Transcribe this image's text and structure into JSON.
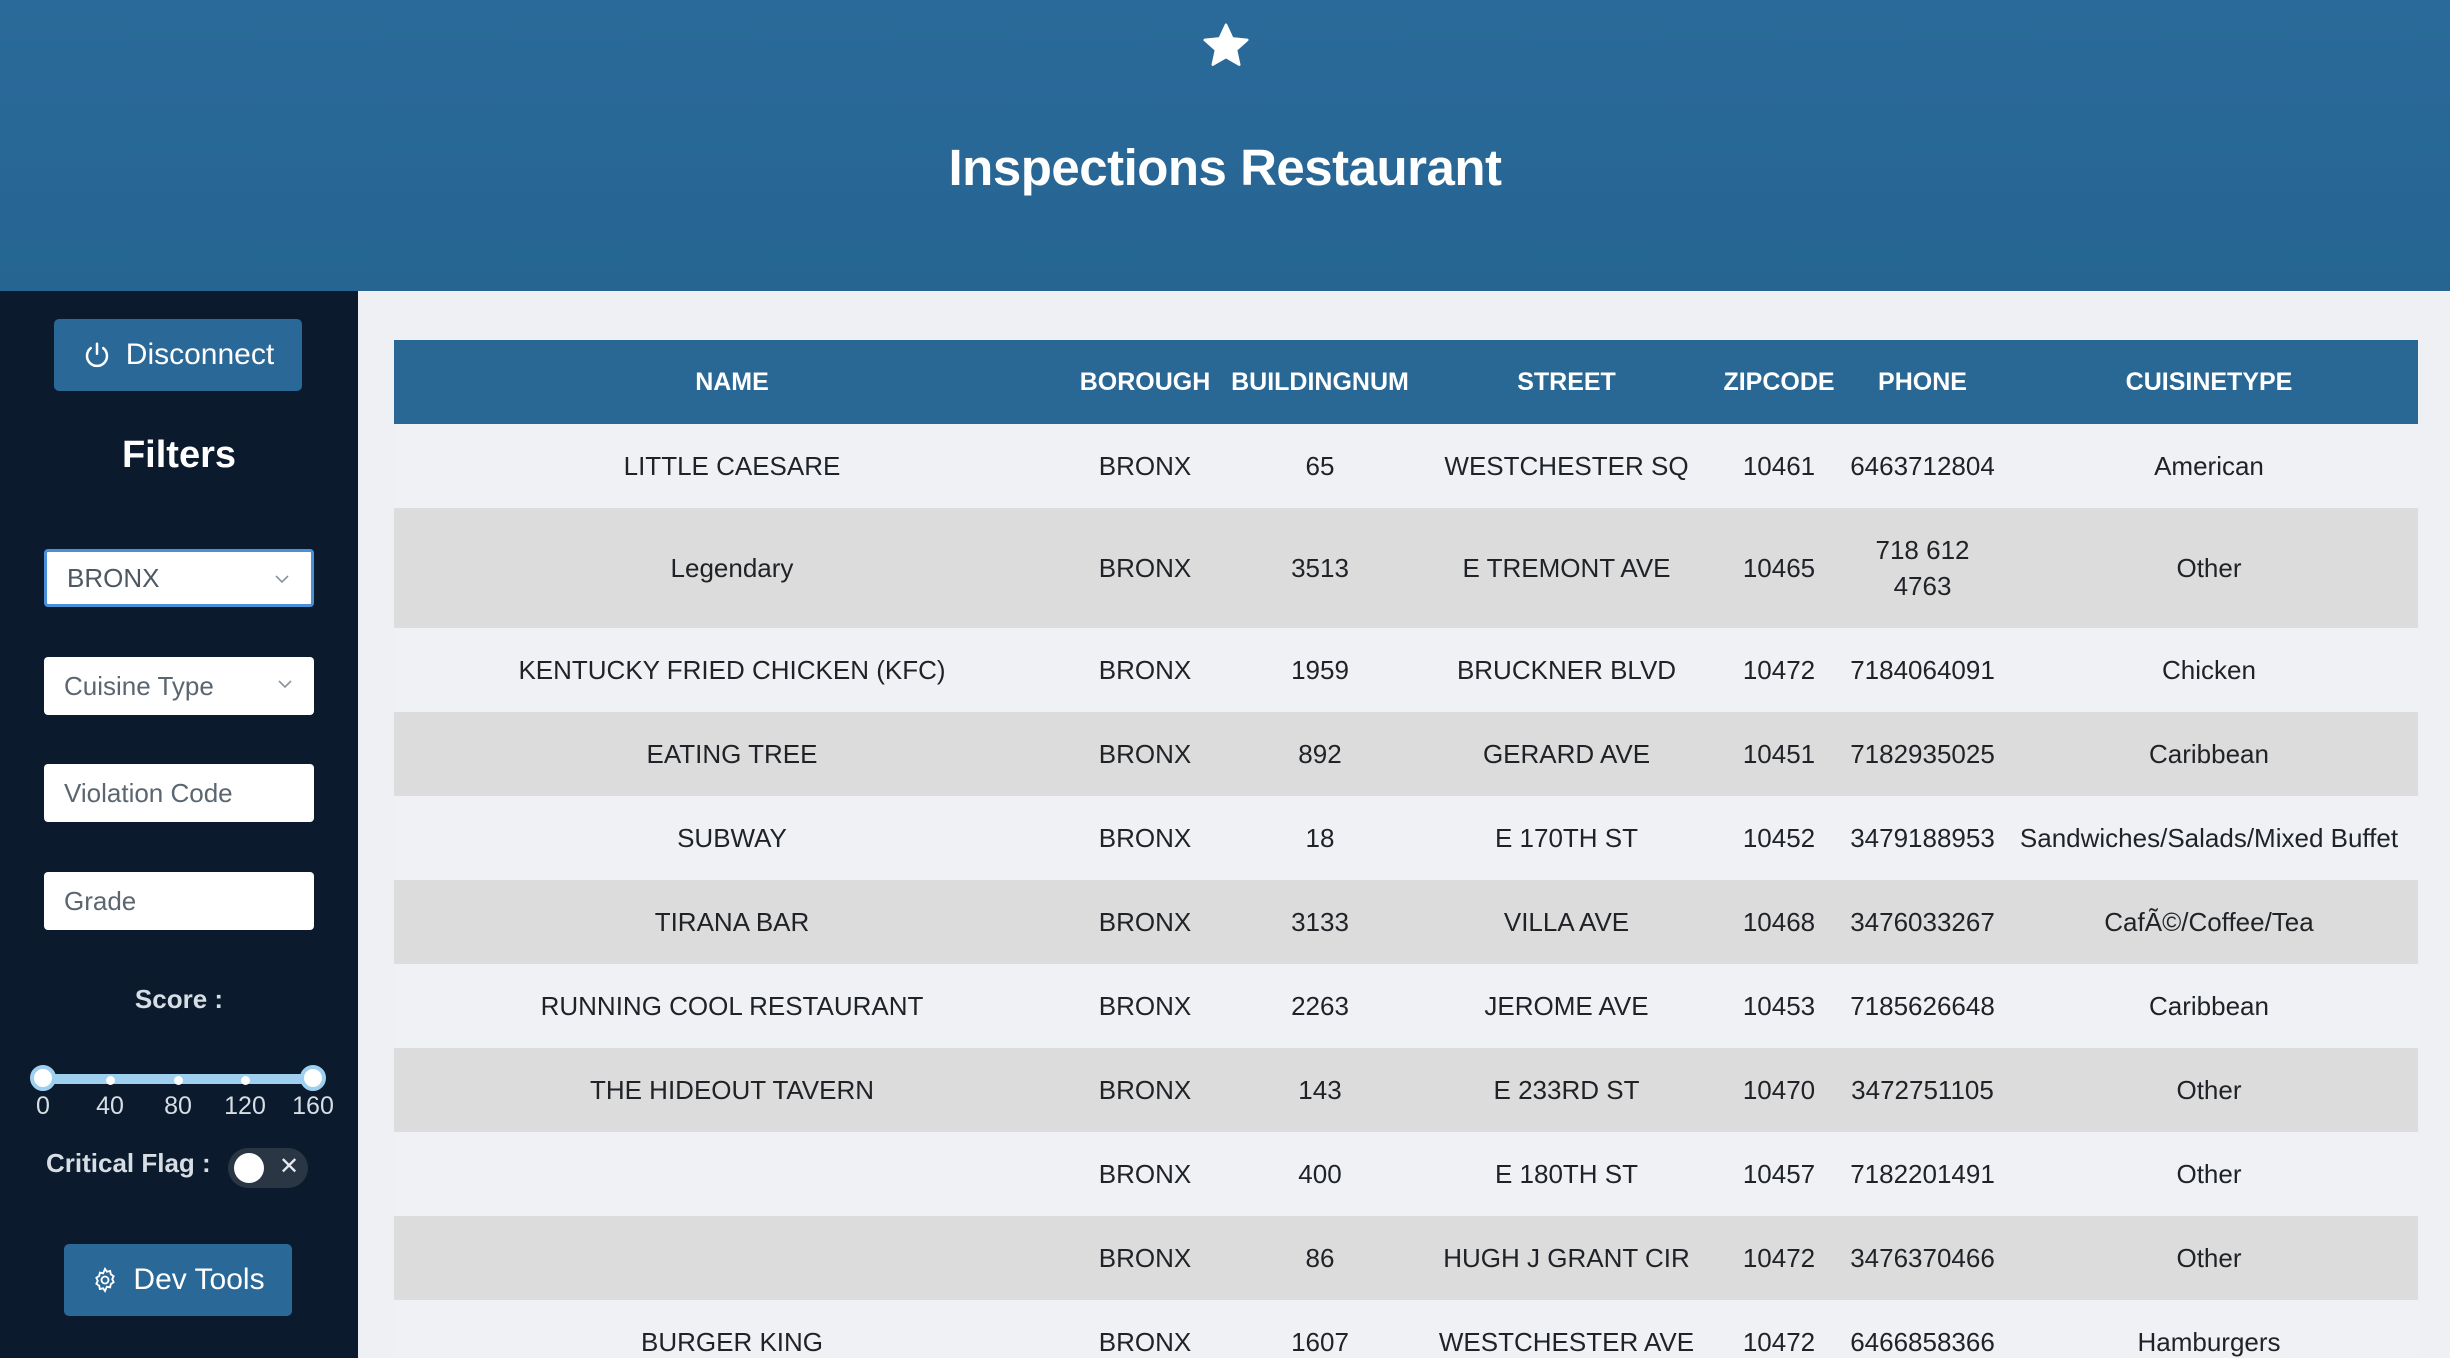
{
  "header": {
    "title": "Inspections Restaurant",
    "icon": "star-icon"
  },
  "sidebar": {
    "disconnect_label": "Disconnect",
    "filters_title": "Filters",
    "borough_value": "BRONX",
    "cuisine_placeholder": "Cuisine Type",
    "violation_placeholder": "Violation Code",
    "grade_placeholder": "Grade",
    "score_label": "Score :",
    "score_ticks": [
      "0",
      "40",
      "80",
      "120",
      "160"
    ],
    "score_range": [
      0,
      160
    ],
    "critical_label": "Critical Flag :",
    "critical_on": false,
    "devtools_label": "Dev Tools"
  },
  "table": {
    "columns": [
      "NAME",
      "BOROUGH",
      "BUILDINGNUM",
      "STREET",
      "ZIPCODE",
      "PHONE",
      "CUISINETYPE"
    ],
    "rows": [
      [
        "LITTLE CAESARE",
        "BRONX",
        "65",
        "WESTCHESTER SQ",
        "10461",
        "6463712804",
        "American"
      ],
      [
        "Legendary",
        "BRONX",
        "3513",
        "E TREMONT AVE",
        "10465",
        "718 612 4763",
        "Other"
      ],
      [
        "KENTUCKY FRIED CHICKEN (KFC)",
        "BRONX",
        "1959",
        "BRUCKNER BLVD",
        "10472",
        "7184064091",
        "Chicken"
      ],
      [
        "EATING TREE",
        "BRONX",
        "892",
        "GERARD AVE",
        "10451",
        "7182935025",
        "Caribbean"
      ],
      [
        "SUBWAY",
        "BRONX",
        "18",
        "E 170TH ST",
        "10452",
        "3479188953",
        "Sandwiches/Salads/Mixed Buffet"
      ],
      [
        "TIRANA BAR",
        "BRONX",
        "3133",
        "VILLA AVE",
        "10468",
        "3476033267",
        "CafÃ©/Coffee/Tea"
      ],
      [
        "RUNNING COOL RESTAURANT",
        "BRONX",
        "2263",
        "JEROME AVE",
        "10453",
        "7185626648",
        "Caribbean"
      ],
      [
        "THE HIDEOUT TAVERN",
        "BRONX",
        "143",
        "E 233RD ST",
        "10470",
        "3472751105",
        "Other"
      ],
      [
        "",
        "BRONX",
        "400",
        "E 180TH ST",
        "10457",
        "7182201491",
        "Other"
      ],
      [
        "",
        "BRONX",
        "86",
        "HUGH J GRANT CIR",
        "10472",
        "3476370466",
        "Other"
      ],
      [
        "BURGER KING",
        "BRONX",
        "1607",
        "WESTCHESTER AVE",
        "10472",
        "6466858366",
        "Hamburgers"
      ]
    ]
  },
  "colors": {
    "header_bg": "#2a6a9a",
    "sidebar_bg": "#0b1a2c",
    "accent": "#2a6898",
    "slider": "#9fd0f0"
  }
}
